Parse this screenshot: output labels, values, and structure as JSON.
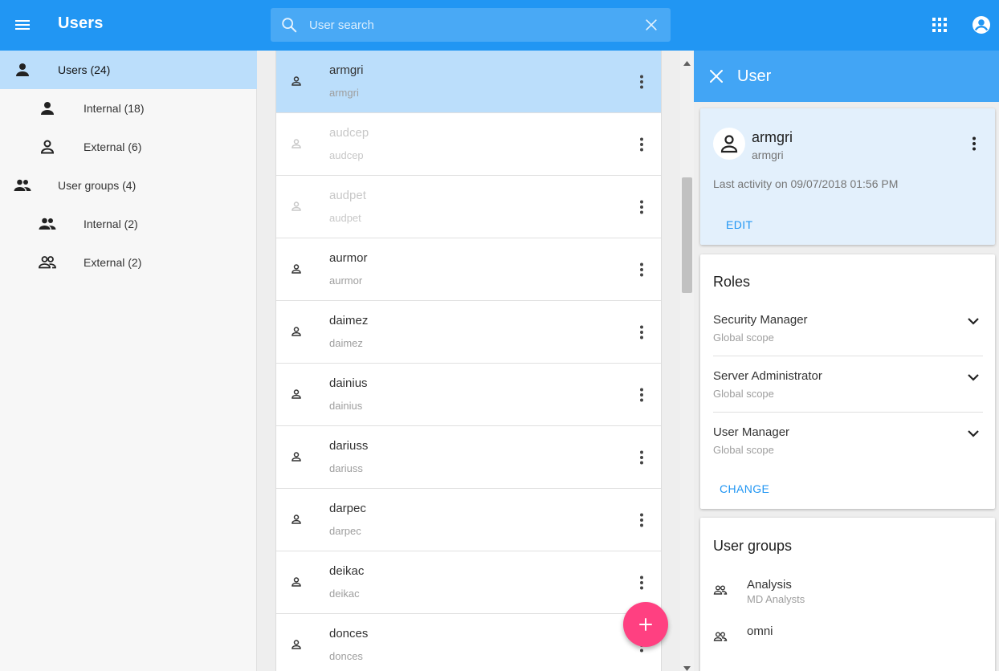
{
  "header": {
    "title": "Users",
    "search_placeholder": "User search"
  },
  "sidebar": {
    "items": [
      {
        "label": "Users (24)",
        "icon": "person-icon"
      },
      {
        "label": "Internal (18)",
        "icon": "person-icon"
      },
      {
        "label": "External (6)",
        "icon": "person-outline-icon"
      },
      {
        "label": "User groups (4)",
        "icon": "people-icon"
      },
      {
        "label": "Internal (2)",
        "icon": "people-icon"
      },
      {
        "label": "External (2)",
        "icon": "people-outline-icon"
      }
    ]
  },
  "users": [
    {
      "name": "armgri",
      "login": "armgri"
    },
    {
      "name": "audcep",
      "login": "audcep"
    },
    {
      "name": "audpet",
      "login": "audpet"
    },
    {
      "name": "aurmor",
      "login": "aurmor"
    },
    {
      "name": "daimez",
      "login": "daimez"
    },
    {
      "name": "dainius",
      "login": "dainius"
    },
    {
      "name": "dariuss",
      "login": "dariuss"
    },
    {
      "name": "darpec",
      "login": "darpec"
    },
    {
      "name": "deikac",
      "login": "deikac"
    },
    {
      "name": "donces",
      "login": "donces"
    }
  ],
  "panel": {
    "title": "User",
    "user": {
      "name": "armgri",
      "login": "armgri",
      "activity": "Last activity on 09/07/2018 01:56 PM",
      "edit_label": "EDIT"
    },
    "roles": {
      "title": "Roles",
      "items": [
        {
          "name": "Security Manager",
          "scope": "Global scope"
        },
        {
          "name": "Server Administrator",
          "scope": "Global scope"
        },
        {
          "name": "User Manager",
          "scope": "Global scope"
        }
      ],
      "change_label": "CHANGE"
    },
    "groups": {
      "title": "User groups",
      "items": [
        {
          "name": "Analysis",
          "desc": "MD Analysts"
        },
        {
          "name": "omni",
          "desc": ""
        }
      ]
    }
  },
  "colors": {
    "primary": "#2196f3",
    "panel_header": "#42a5f5",
    "selected": "#bbdefb",
    "fab": "#ff4081"
  }
}
